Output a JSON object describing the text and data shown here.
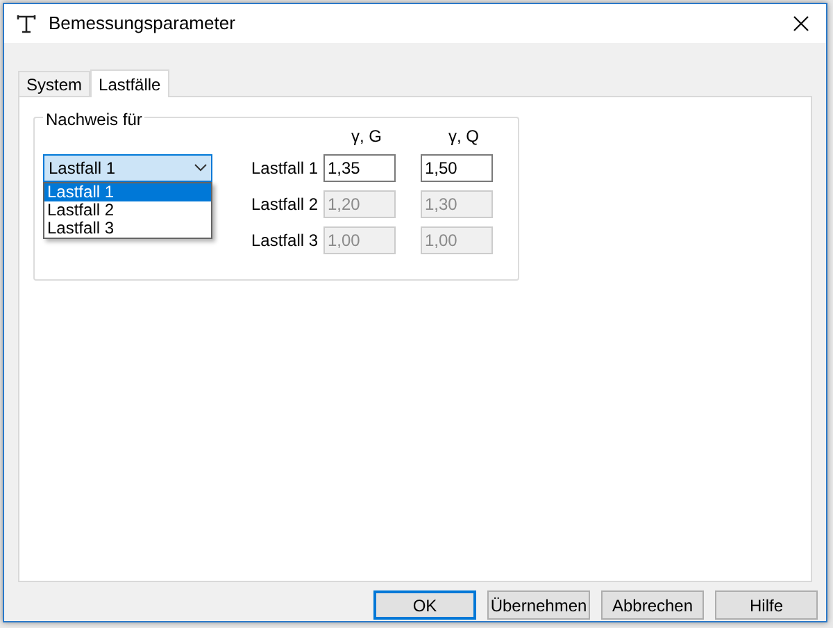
{
  "window": {
    "title": "Bemessungsparameter"
  },
  "tabs": [
    {
      "label": "System",
      "selected": false
    },
    {
      "label": "Lastfälle",
      "selected": true
    }
  ],
  "group": {
    "title": "Nachweis für",
    "dropdown": {
      "value": "Lastfall 1",
      "expanded": true,
      "options": [
        {
          "label": "Lastfall 1",
          "selected": true
        },
        {
          "label": "Lastfall 2",
          "selected": false
        },
        {
          "label": "Lastfall 3",
          "selected": false
        }
      ]
    },
    "columns": [
      "γ, G",
      "γ, Q"
    ],
    "rows": [
      {
        "label": "Lastfall 1",
        "values": [
          {
            "value": "1,35",
            "disabled": false
          },
          {
            "value": "1,50",
            "disabled": false
          }
        ]
      },
      {
        "label": "Lastfall 2",
        "values": [
          {
            "value": "1,20",
            "disabled": true
          },
          {
            "value": "1,30",
            "disabled": true
          }
        ]
      },
      {
        "label": "Lastfall 3",
        "values": [
          {
            "value": "1,00",
            "disabled": true
          },
          {
            "value": "1,00",
            "disabled": true
          }
        ]
      }
    ]
  },
  "buttons": [
    {
      "label": "OK",
      "default": true
    },
    {
      "label": "Übernehmen",
      "default": false
    },
    {
      "label": "Abbrechen",
      "default": false
    },
    {
      "label": "Hilfe",
      "default": false
    }
  ]
}
